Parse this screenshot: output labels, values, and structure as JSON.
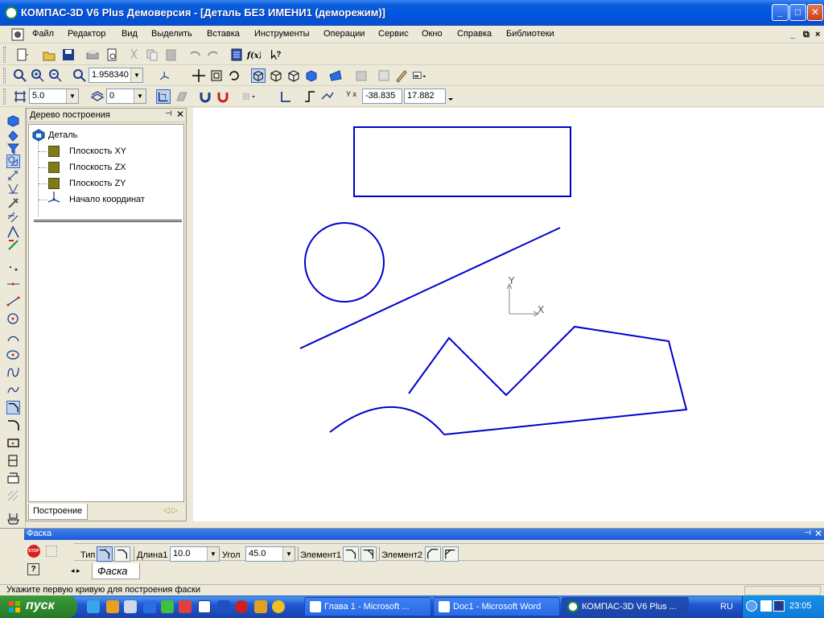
{
  "window": {
    "title": "КОМПАС-3D V6 Plus Демоверсия - [Деталь БЕЗ ИМЕНИ1 (деморежим)]",
    "min": "_",
    "max": "□",
    "close": "✕"
  },
  "menu": {
    "items": [
      "Файл",
      "Редактор",
      "Вид",
      "Выделить",
      "Вставка",
      "Инструменты",
      "Операции",
      "Сервис",
      "Окно",
      "Справка",
      "Библиотеки"
    ],
    "mdi": [
      "_",
      "⧉",
      "×"
    ]
  },
  "toolbar_view": {
    "zoom_value": "1.958340"
  },
  "toolbar_params": {
    "step_value": "5.0",
    "layer_value": "0",
    "coord_x": "-38.835",
    "coord_y": "17.882",
    "coord_label": "Y x"
  },
  "tree": {
    "title": "Дерево построения",
    "pin": "⊣",
    "close": "✕",
    "root": "Деталь",
    "nodes": [
      "Плоскость XY",
      "Плоскость ZX",
      "Плоскость ZY",
      "Начало координат"
    ],
    "tab": "Построение",
    "navs": "◁ ▷"
  },
  "canvas": {
    "axis_x": "X",
    "axis_y": "Y",
    "stroke_color": "#0000cc"
  },
  "props": {
    "title": "Фаска",
    "pin": "⊣",
    "close": "✕",
    "stop": "STOP",
    "help": "?",
    "type_label": "Тип",
    "length_label": "Длина1",
    "length_value": "10.0",
    "angle_label": "Угол",
    "angle_value": "45.0",
    "element1_label": "Элемент1",
    "element2_label": "Элемент2",
    "tab": "Фаска",
    "navs": "◂ ▸"
  },
  "status": {
    "text": "Укажите первую кривую для построения фаски"
  },
  "taskbar": {
    "start": "пуск",
    "tasks": [
      "Глава 1 - Microsoft ...",
      "Doc1 - Microsoft Word",
      "КОМПАС-3D V6 Plus ..."
    ],
    "lang": "RU",
    "clock": "23:05"
  }
}
